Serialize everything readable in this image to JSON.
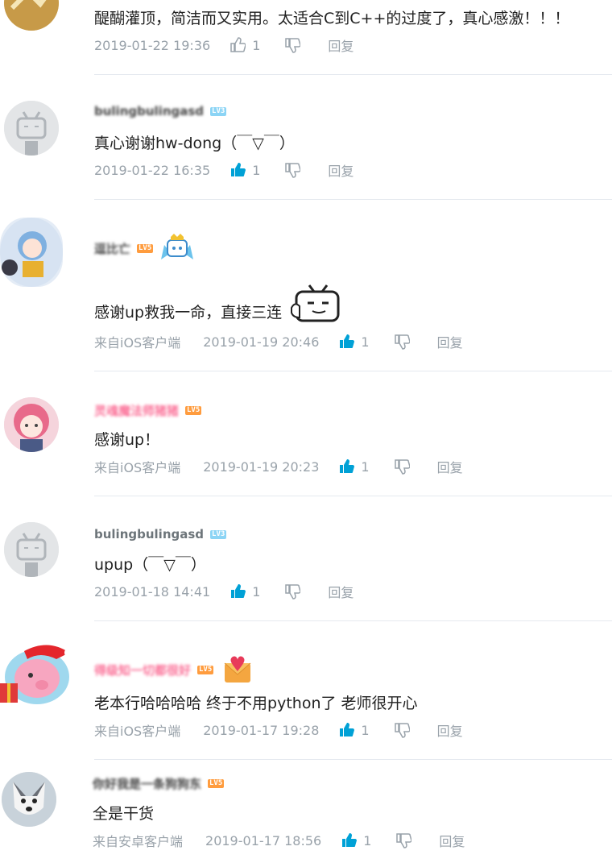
{
  "colors": {
    "text": "#222222",
    "meta": "#99a2aa",
    "like_active": "#00a1d6",
    "divider": "#e5e9ef",
    "lv3": "#8bd4f5",
    "lv5": "#ff9c3e"
  },
  "comments": [
    {
      "username": "",
      "level": "",
      "text": "醍醐灌顶，简洁而又实用。太适合C到C++的过度了，真心感激！！！",
      "source": "",
      "time": "2019-01-22 19:36",
      "likes": "1",
      "liked": false,
      "reply": "回复"
    },
    {
      "username": "bulingbulingasd",
      "level": "LV3",
      "text": "真心谢谢hw-dong（￣▽￣）",
      "source": "",
      "time": "2019-01-22 16:35",
      "likes": "1",
      "liked": true,
      "reply": "回复"
    },
    {
      "username": "逗比亡",
      "level": "LV5",
      "text": "感谢up救我一命，直接三连",
      "source": "来自iOS客户端",
      "time": "2019-01-19 20:46",
      "likes": "1",
      "liked": true,
      "reply": "回复"
    },
    {
      "username": "灵魂魔法师猪猪",
      "level": "LV5",
      "text": "感谢up！",
      "source": "来自iOS客户端",
      "time": "2019-01-19 20:23",
      "likes": "1",
      "liked": true,
      "reply": "回复"
    },
    {
      "username": "bulingbulingasd",
      "level": "LV3",
      "text": "upup（￣▽￣）",
      "source": "",
      "time": "2019-01-18 14:41",
      "likes": "1",
      "liked": true,
      "reply": "回复"
    },
    {
      "username": "得级知一切都很好",
      "level": "LV5",
      "text": "老本行哈哈哈哈 终于不用python了 老师很开心",
      "source": "来自iOS客户端",
      "time": "2019-01-17 19:28",
      "likes": "1",
      "liked": true,
      "reply": "回复"
    },
    {
      "username": "你好我是一条狗狗东",
      "level": "LV5",
      "text": "全是干货",
      "source": "来自安卓客户端",
      "time": "2019-01-17 18:56",
      "likes": "1",
      "liked": true,
      "reply": "回复"
    }
  ]
}
